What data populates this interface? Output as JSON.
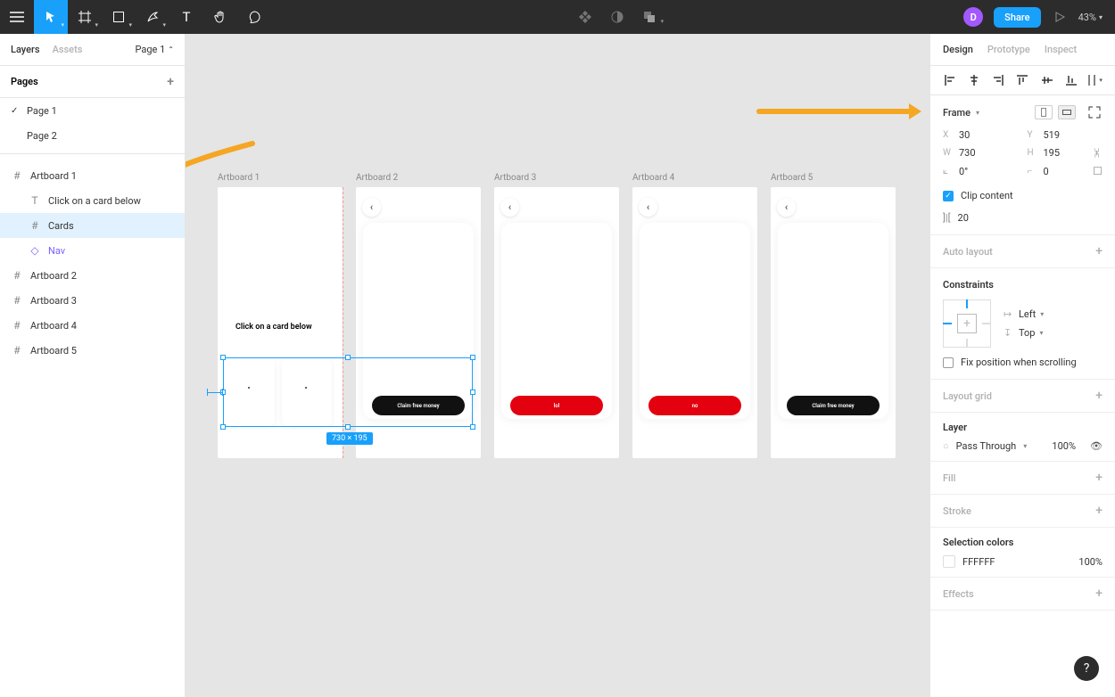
{
  "topbar": {
    "avatar_initial": "D",
    "share_label": "Share",
    "zoom": "43%"
  },
  "left_panel": {
    "tabs": {
      "layers": "Layers",
      "assets": "Assets"
    },
    "page_selector": "Page 1",
    "pages_header": "Pages",
    "pages": [
      "Page 1",
      "Page 2"
    ],
    "layers": [
      {
        "name": "Artboard 1",
        "type": "frame",
        "indent": 0
      },
      {
        "name": "Click on a card below",
        "type": "text",
        "indent": 1
      },
      {
        "name": "Cards",
        "type": "frame",
        "indent": 1,
        "selected": true
      },
      {
        "name": "Nav",
        "type": "component",
        "indent": 1
      },
      {
        "name": "Artboard 2",
        "type": "frame",
        "indent": 0
      },
      {
        "name": "Artboard 3",
        "type": "frame",
        "indent": 0
      },
      {
        "name": "Artboard 4",
        "type": "frame",
        "indent": 0
      },
      {
        "name": "Artboard 5",
        "type": "frame",
        "indent": 0
      }
    ]
  },
  "canvas": {
    "artboards": [
      {
        "label": "Artboard 1",
        "text": "Click on a card below"
      },
      {
        "label": "Artboard 2",
        "button_label": "Claim free money",
        "button_style": "black"
      },
      {
        "label": "Artboard 3",
        "button_label": "lol",
        "button_style": "red"
      },
      {
        "label": "Artboard 4",
        "button_label": "no",
        "button_style": "red"
      },
      {
        "label": "Artboard 5",
        "button_label": "Claim free money",
        "button_style": "black"
      }
    ],
    "selection_dim": "730 × 195"
  },
  "right_panel": {
    "tabs": {
      "design": "Design",
      "prototype": "Prototype",
      "inspect": "Inspect"
    },
    "frame_label": "Frame",
    "x": "30",
    "y": "519",
    "w": "730",
    "h": "195",
    "rotation": "0°",
    "corner": "0",
    "clip_content": "Clip content",
    "gap": "20",
    "auto_layout": "Auto layout",
    "constraints_title": "Constraints",
    "constraint_h": "Left",
    "constraint_v": "Top",
    "fix_scroll": "Fix position when scrolling",
    "layout_grid": "Layout grid",
    "layer_title": "Layer",
    "blend_mode": "Pass Through",
    "opacity": "100%",
    "fill": "Fill",
    "stroke": "Stroke",
    "selection_colors": "Selection colors",
    "sel_color_hex": "FFFFFF",
    "sel_color_opacity": "100%",
    "effects": "Effects"
  }
}
